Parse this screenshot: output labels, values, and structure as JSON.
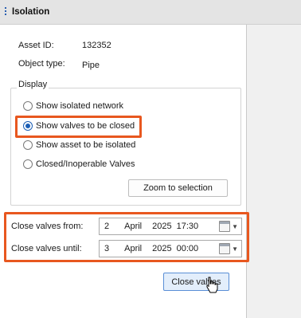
{
  "window": {
    "title": "Isolation"
  },
  "asset": {
    "id_label": "Asset ID:",
    "id_value": "132352",
    "type_label": "Object type:",
    "type_value": "Pipe"
  },
  "display": {
    "group_label": "Display",
    "options": [
      {
        "label": "Show isolated network",
        "checked": false
      },
      {
        "label": "Show valves to be closed",
        "checked": true
      },
      {
        "label": "Show asset to be isolated",
        "checked": false
      },
      {
        "label": "Closed/Inoperable Valves",
        "checked": false
      }
    ],
    "zoom_button": "Zoom to selection"
  },
  "valves": {
    "from_label": "Close valves from:",
    "from": {
      "day": "2",
      "month": "April",
      "year": "2025",
      "time": "17:30"
    },
    "until_label": "Close valves until:",
    "until": {
      "day": "3",
      "month": "April",
      "year": "2025",
      "time": "00:00"
    },
    "close_button": "Close valves"
  },
  "colors": {
    "highlight": "#e8571f",
    "accent": "#1c5fb5"
  }
}
